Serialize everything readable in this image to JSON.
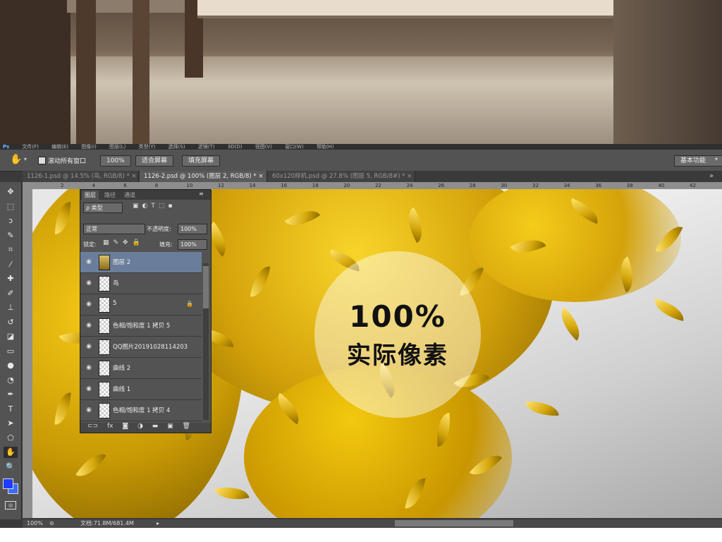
{
  "menu": {
    "logo": "Ps",
    "items": [
      "文件(F)",
      "编辑(E)",
      "图像(I)",
      "图层(L)",
      "类型(Y)",
      "选择(S)",
      "滤镜(T)",
      "3D(D)",
      "视图(V)",
      "窗口(W)",
      "帮助(H)"
    ]
  },
  "options": {
    "scroll_all_label": "滚动所有窗口",
    "zoom_100": "100%",
    "fit_screen": "适合屏幕",
    "fill_screen": "填充屏幕",
    "workspace": "基本功能"
  },
  "tabs": [
    {
      "label": "1126-1.psd @ 14.5% (鸟, RGB/8) *"
    },
    {
      "label": "1126-2.psd @ 100% (图层 2, RGB/8) *"
    },
    {
      "label": "60x120样机.psd @ 27.8% (图层 5, RGB/8#) *"
    }
  ],
  "ruler_ticks": [
    "2",
    "4",
    "6",
    "8",
    "10",
    "12",
    "14",
    "16",
    "18",
    "20",
    "22",
    "24",
    "26",
    "28",
    "30",
    "32",
    "34",
    "36",
    "38",
    "40",
    "42"
  ],
  "tools": [
    {
      "icon": "move-icon",
      "glyph": "✥"
    },
    {
      "icon": "marquee-icon",
      "glyph": "⬚"
    },
    {
      "icon": "lasso-icon",
      "glyph": "ↄ"
    },
    {
      "icon": "quick-select-icon",
      "glyph": "✎"
    },
    {
      "icon": "crop-icon",
      "glyph": "⌗"
    },
    {
      "icon": "eyedropper-icon",
      "glyph": "⁄"
    },
    {
      "icon": "healing-icon",
      "glyph": "✚"
    },
    {
      "icon": "brush-icon",
      "glyph": "✐"
    },
    {
      "icon": "stamp-icon",
      "glyph": "⊥"
    },
    {
      "icon": "history-brush-icon",
      "glyph": "↺"
    },
    {
      "icon": "eraser-icon",
      "glyph": "◪"
    },
    {
      "icon": "gradient-icon",
      "glyph": "▭"
    },
    {
      "icon": "blur-icon",
      "glyph": "●"
    },
    {
      "icon": "dodge-icon",
      "glyph": "◔"
    },
    {
      "icon": "pen-icon",
      "glyph": "✒"
    },
    {
      "icon": "type-icon",
      "glyph": "T"
    },
    {
      "icon": "path-select-icon",
      "glyph": "➤"
    },
    {
      "icon": "shape-icon",
      "glyph": "⬠"
    },
    {
      "icon": "hand-icon",
      "glyph": "✋"
    },
    {
      "icon": "zoom-icon",
      "glyph": "🔍"
    }
  ],
  "colors": {
    "foreground": "#1f3cff",
    "background": "#3b6df0",
    "selected_layer": "#6a7e9b"
  },
  "canvas": {
    "badge_number": "100%",
    "badge_text": "实际像素"
  },
  "layers_panel": {
    "tabs": [
      "图层",
      "路径",
      "通道"
    ],
    "filter_kind": "ρ 类型",
    "blend_mode": "正常",
    "opacity_label": "不透明度:",
    "opacity_value": "100%",
    "lock_label": "锁定:",
    "fill_label": "填充:",
    "fill_value": "100%",
    "layers": [
      {
        "name": "图层 2",
        "selected": true,
        "thumb": "img",
        "locked": false
      },
      {
        "name": "鸟",
        "selected": false,
        "thumb": "trans",
        "locked": false
      },
      {
        "name": "5",
        "selected": false,
        "thumb": "trans",
        "locked": true
      },
      {
        "name": "色相/饱和度 1 拷贝 5",
        "selected": false,
        "thumb": "trans",
        "locked": false
      },
      {
        "name": "QQ图片20191028114203",
        "selected": false,
        "thumb": "trans",
        "locked": false
      },
      {
        "name": "曲线 2",
        "selected": false,
        "thumb": "trans",
        "locked": false
      },
      {
        "name": "曲线 1",
        "selected": false,
        "thumb": "trans",
        "locked": false
      },
      {
        "name": "色相/饱和度 1 拷贝 4",
        "selected": false,
        "thumb": "trans",
        "locked": false
      }
    ],
    "footer_icons": [
      "link-icon",
      "fx-icon",
      "mask-icon",
      "adjustment-icon",
      "folder-icon",
      "new-layer-icon",
      "trash-icon"
    ]
  },
  "status": {
    "zoom": "100%",
    "doc_size": "文档:71.8M/681.4M"
  }
}
